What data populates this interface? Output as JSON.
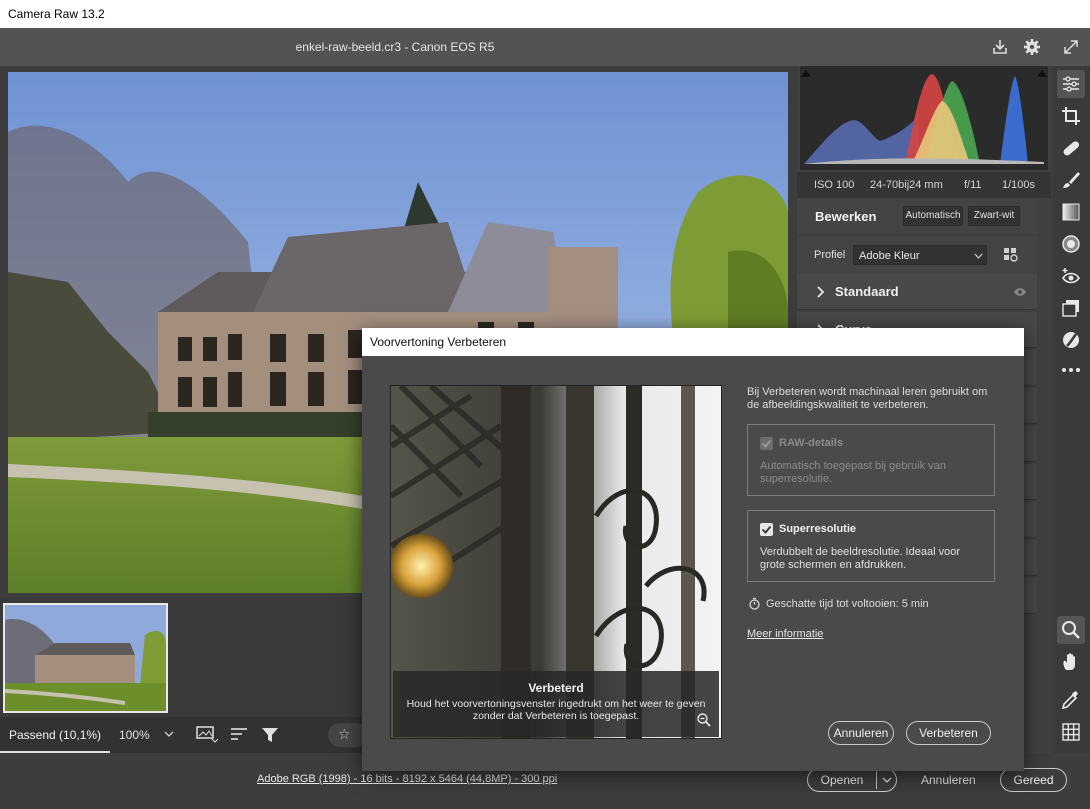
{
  "window": {
    "title": "Camera Raw 13.2"
  },
  "header": {
    "file_title": "enkel-raw-beeld.cr3  -  Canon EOS R5",
    "icons": [
      "save-icon",
      "gear-icon",
      "fullscreen-icon"
    ]
  },
  "exif": {
    "iso": "ISO 100",
    "lens": "24-70bij24 mm",
    "aperture": "f/11",
    "shutter": "1/100s"
  },
  "edit_panel": {
    "title": "Bewerken",
    "auto_label": "Automatisch",
    "bw_label": "Zwart-wit",
    "profile_label": "Profiel",
    "profile_value": "Adobe Kleur",
    "section_basic": "Standaard",
    "section_curve": "Curve"
  },
  "tools": [
    "edit-sliders-icon",
    "crop-icon",
    "healing-icon",
    "brush-icon",
    "gradient-icon",
    "radial-icon",
    "redeye-icon",
    "presets-icon",
    "mask-icon",
    "more-icon",
    "zoom-icon",
    "hand-icon",
    "eyedropper-icon",
    "grid-icon"
  ],
  "viewbar": {
    "fit_label": "Passend (10,1%)",
    "zoom_value": "100%"
  },
  "footer": {
    "workflow": "Adobe RGB (1998) - 16 bits - 8192 x 5464 (44,8MP) - 300 ppi",
    "open_label": "Openen",
    "cancel_label": "Annuleren",
    "done_label": "Gereed"
  },
  "dialog": {
    "title": "Voorvertoning Verbeteren",
    "intro": "Bij Verbeteren wordt machinaal leren gebruikt om de afbeeldingskwaliteit te verbeteren.",
    "raw_details": {
      "label": "RAW-details",
      "checked": true,
      "disabled": true,
      "description": "Automatisch toegepast bij gebruik van superresolutie."
    },
    "super_resolution": {
      "label": "Superresolutie",
      "checked": true,
      "description": "Verdubbelt de beeldresolutie. Ideaal voor grote schermen en afdrukken."
    },
    "estimate": "Geschatte tijd tot voltooien: 5 min",
    "more_info": "Meer informatie",
    "preview_caption_title": "Verbeterd",
    "preview_caption_text": "Houd het voorvertoningsvenster ingedrukt om het weer te geven zonder dat Verbeteren is toegepast.",
    "cancel_label": "Annuleren",
    "enhance_label": "Verbeteren"
  },
  "colors": {
    "accent_white": "#ffffff",
    "panel": "#404040",
    "dialog_bg": "#4a4a4a"
  }
}
